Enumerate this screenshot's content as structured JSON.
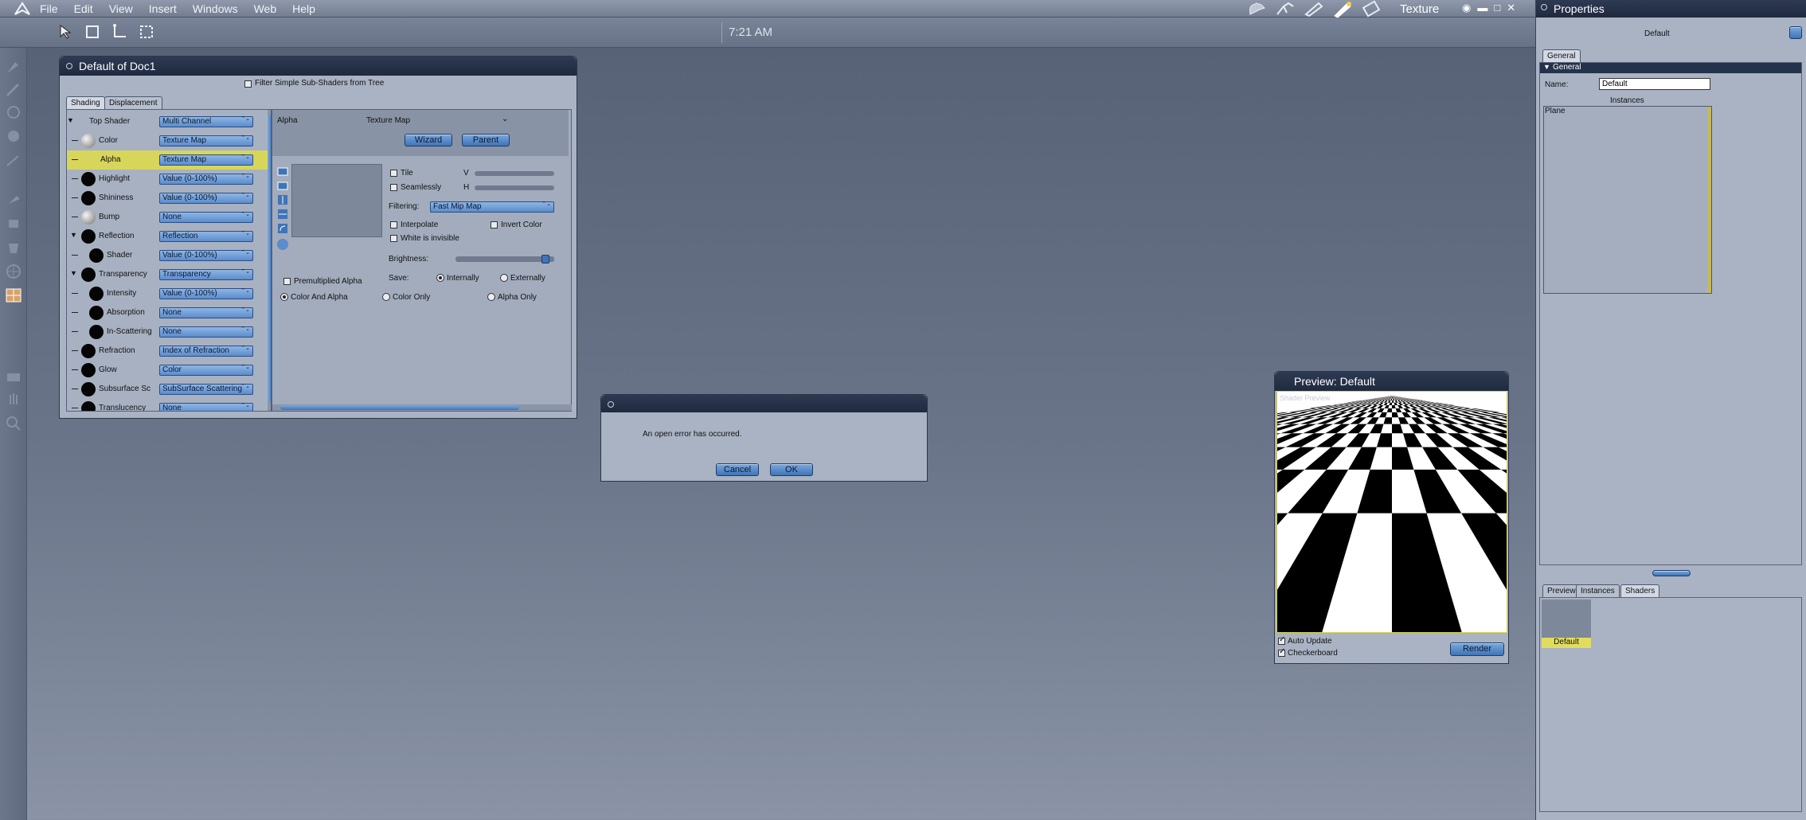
{
  "menubar": {
    "items": [
      "File",
      "Edit",
      "View",
      "Insert",
      "Windows",
      "Web",
      "Help"
    ],
    "room_title": "Texture",
    "room_icons": [
      "hand-room-icon",
      "pose-room-icon",
      "face-room-icon",
      "texture-room-icon",
      "cloth-room-icon"
    ]
  },
  "toolbar": {
    "clock": "7:21 AM"
  },
  "shader_panel": {
    "title": "Default of Doc1",
    "filter_label": "Filter Simple Sub-Shaders from Tree",
    "tabs": [
      "Shading",
      "Displacement"
    ],
    "tree": [
      {
        "label": "Top Shader",
        "value": "Multi Channel",
        "indent": 0,
        "ball": "none",
        "expanded": true
      },
      {
        "label": "Color",
        "value": "Texture Map",
        "indent": 1,
        "ball": "grey"
      },
      {
        "label": "Alpha",
        "value": "Texture Map",
        "indent": 1,
        "ball": "none",
        "selected": true
      },
      {
        "label": "Highlight",
        "value": "Value (0-100%)",
        "indent": 1,
        "ball": "black"
      },
      {
        "label": "Shininess",
        "value": "Value (0-100%)",
        "indent": 1,
        "ball": "black"
      },
      {
        "label": "Bump",
        "value": "None",
        "indent": 1,
        "ball": "grey"
      },
      {
        "label": "Reflection",
        "value": "Reflection",
        "indent": 1,
        "ball": "black",
        "expanded": true
      },
      {
        "label": "Shader",
        "value": "Value (0-100%)",
        "indent": 2,
        "ball": "black"
      },
      {
        "label": "Transparency",
        "value": "Transparency",
        "indent": 1,
        "ball": "black",
        "expanded": true
      },
      {
        "label": "Intensity",
        "value": "Value (0-100%)",
        "indent": 2,
        "ball": "black"
      },
      {
        "label": "Absorption",
        "value": "None",
        "indent": 2,
        "ball": "black"
      },
      {
        "label": "In-Scattering",
        "value": "None",
        "indent": 2,
        "ball": "black"
      },
      {
        "label": "Refraction",
        "value": "Index of Refraction",
        "indent": 1,
        "ball": "black"
      },
      {
        "label": "Glow",
        "value": "Color",
        "indent": 1,
        "ball": "black"
      },
      {
        "label": "Subsurface Sc",
        "value": "SubSurface Scattering",
        "indent": 1,
        "ball": "black"
      },
      {
        "label": "Translucency",
        "value": "None",
        "indent": 1,
        "ball": "black"
      }
    ],
    "editor": {
      "channel": "Alpha",
      "type": "Texture Map",
      "wizard": "Wizard",
      "parent": "Parent",
      "tile": "Tile",
      "seamlessly": "Seamlessly",
      "v_label": "V",
      "h_label": "H",
      "filtering_label": "Filtering:",
      "filtering_value": "Fast Mip Map",
      "interpolate": "Interpolate",
      "invert_color": "Invert Color",
      "white_invisible": "White is invisible",
      "brightness": "Brightness:",
      "save_label": "Save:",
      "internally": "Internally",
      "externally": "Externally",
      "premultiplied": "Premultiplied Alpha",
      "color_and_alpha": "Color And Alpha",
      "color_only": "Color Only",
      "alpha_only": "Alpha Only"
    }
  },
  "dialog": {
    "message": "An open error has occurred.",
    "cancel": "Cancel",
    "ok": "OK"
  },
  "preview_panel": {
    "title": "Preview: Default",
    "overlay_text": "Shader Preview",
    "auto_update": "Auto Update",
    "checkerboard": "Checkerboard",
    "render": "Render"
  },
  "properties_panel": {
    "title": "Properties",
    "object_name": "Default",
    "tab_general": "General",
    "section_general": "General",
    "name_label": "Name:",
    "name_value": "Default",
    "instances_label": "Instances",
    "instances": [
      "Plane"
    ],
    "bottom_tabs": [
      "Preview",
      "Instances",
      "Shaders"
    ],
    "shader_item": "Default"
  }
}
